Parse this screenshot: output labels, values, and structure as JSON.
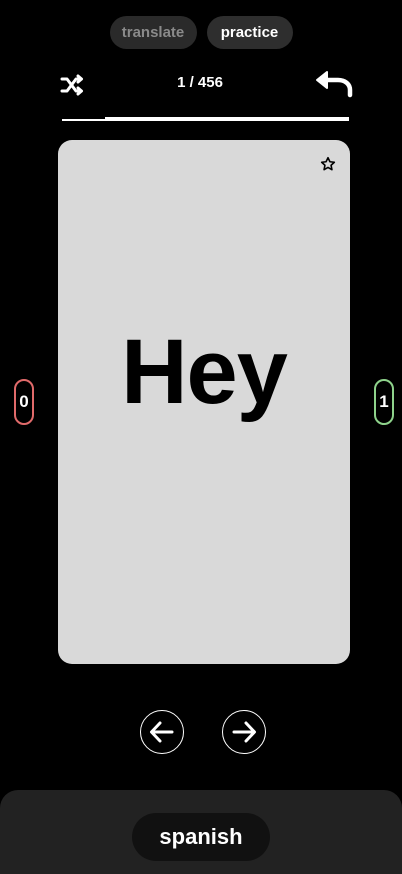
{
  "header": {
    "tabs": [
      {
        "label": "translate",
        "active": false
      },
      {
        "label": "practice",
        "active": true
      }
    ],
    "icons": {
      "shuffle": "shuffle-icon",
      "back": "undo-arrow-icon"
    },
    "counter": "1 / 456",
    "progress": {
      "current": 1,
      "total": 456,
      "fraction": 0.15
    }
  },
  "card": {
    "word": "Hey",
    "favorite_icon": "star-outline-icon",
    "background": "#d9d9d9"
  },
  "scores": {
    "wrong": "0",
    "right": "1",
    "wrong_color": "#e06a6a",
    "right_color": "#8ed28b"
  },
  "navigation": {
    "prev_icon": "arrow-left-icon",
    "next_icon": "arrow-right-icon"
  },
  "footer": {
    "language": "spanish"
  }
}
